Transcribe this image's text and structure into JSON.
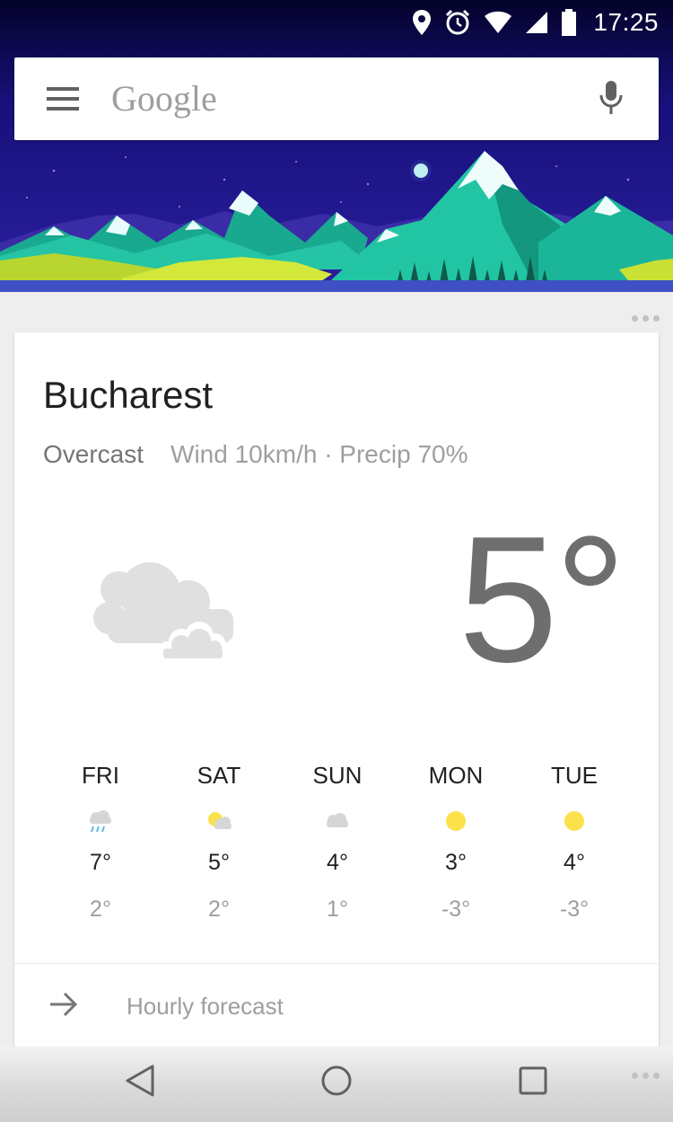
{
  "status_bar": {
    "time": "17:25",
    "icons": [
      "location-icon",
      "alarm-icon",
      "wifi-icon",
      "signal-icon",
      "battery-icon"
    ]
  },
  "search": {
    "brand": "Google",
    "icons": [
      "menu-icon",
      "mic-icon"
    ]
  },
  "weather_card": {
    "city": "Bucharest",
    "condition": "Overcast",
    "details": "Wind 10km/h · Precip 70%",
    "current_temp": "5°",
    "current_icon": "cloudy-icon",
    "forecast": [
      {
        "day": "FRI",
        "icon": "rain-cloud-icon",
        "high": "7°",
        "low": "2°"
      },
      {
        "day": "SAT",
        "icon": "partly-sunny-icon",
        "high": "5°",
        "low": "2°"
      },
      {
        "day": "SUN",
        "icon": "cloud-icon",
        "high": "4°",
        "low": "1°"
      },
      {
        "day": "MON",
        "icon": "sun-icon",
        "high": "3°",
        "low": "-3°"
      },
      {
        "day": "TUE",
        "icon": "sun-icon",
        "high": "4°",
        "low": "-3°"
      }
    ],
    "hourly_label": "Hourly forecast"
  },
  "colors": {
    "sky": "#1f1479",
    "mountain": "#1fc3a6",
    "grass": "#c7dd3c",
    "sun": "#fbe24c",
    "card": "#ffffff"
  },
  "nav_bar": {
    "buttons": [
      "back-icon",
      "home-icon",
      "recents-icon"
    ]
  }
}
